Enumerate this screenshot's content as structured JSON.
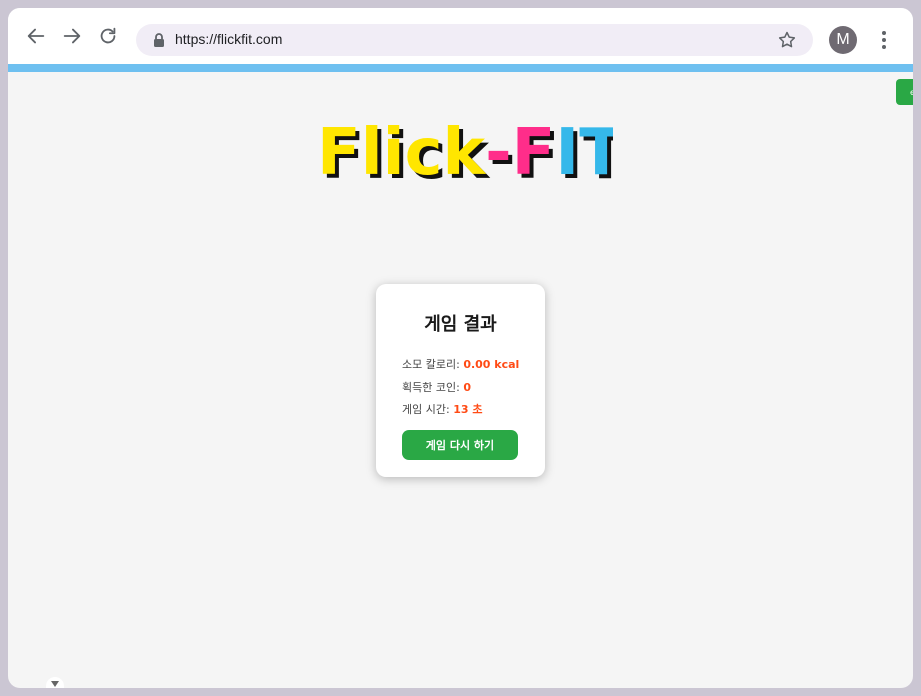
{
  "browser": {
    "url": "https://flickfit.com",
    "profile_initial": "M",
    "icons": [
      "back-arrow-icon",
      "forward-arrow-icon",
      "reload-icon",
      "lock-icon",
      "bookmark-star-icon",
      "more-vert-icon"
    ]
  },
  "logo": {
    "text": "Flick-FIT",
    "colors": {
      "yellow": "#ffe600",
      "pink": "#ff2d8a",
      "blue": "#35b8ea",
      "shadow": "#111111"
    }
  },
  "colors": {
    "accent_bar": "#6ec0f0",
    "button_green": "#2aa845",
    "value_orange": "#ff4a14"
  },
  "result": {
    "title": "게임 결과",
    "calories": {
      "label": "소모 칼로리: ",
      "value": "0.00 kcal"
    },
    "coins": {
      "label": "획득한 코인: ",
      "value": "0"
    },
    "time": {
      "label": "게임 시간: ",
      "value": "13 초"
    },
    "replay_label": "게임 다시 하기"
  }
}
